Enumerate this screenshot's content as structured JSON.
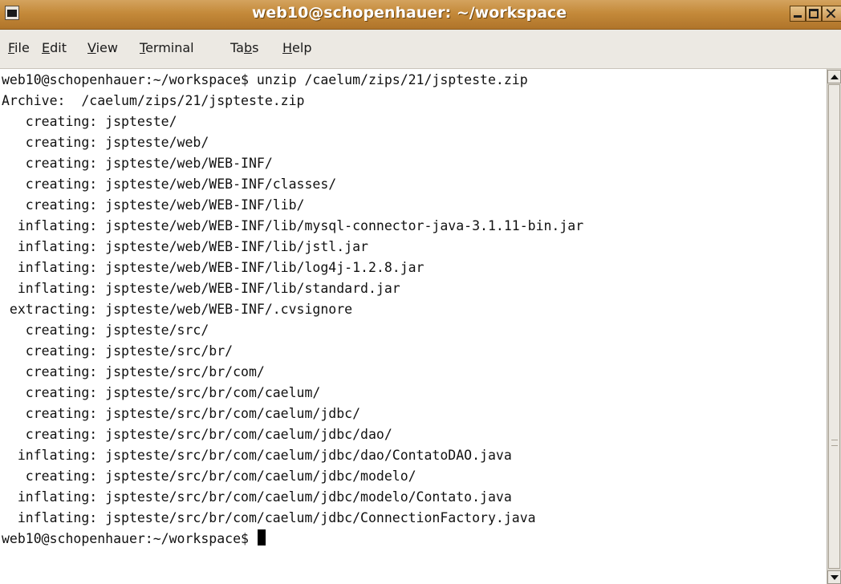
{
  "window": {
    "title": "web10@schopenhauer: ~/workspace"
  },
  "menu": [
    {
      "pre": "",
      "mnemonic": "F",
      "post": "ile"
    },
    {
      "pre": "",
      "mnemonic": "E",
      "post": "dit"
    },
    {
      "pre": "",
      "mnemonic": "V",
      "post": "iew"
    },
    {
      "pre": "",
      "mnemonic": "T",
      "post": "erminal"
    },
    {
      "pre": "Ta",
      "mnemonic": "b",
      "post": "s"
    },
    {
      "pre": "",
      "mnemonic": "H",
      "post": "elp"
    }
  ],
  "terminal": {
    "lines": [
      "web10@schopenhauer:~/workspace$ unzip /caelum/zips/21/jspteste.zip",
      "Archive:  /caelum/zips/21/jspteste.zip",
      "   creating: jspteste/",
      "   creating: jspteste/web/",
      "   creating: jspteste/web/WEB-INF/",
      "   creating: jspteste/web/WEB-INF/classes/",
      "   creating: jspteste/web/WEB-INF/lib/",
      "  inflating: jspteste/web/WEB-INF/lib/mysql-connector-java-3.1.11-bin.jar",
      "  inflating: jspteste/web/WEB-INF/lib/jstl.jar",
      "  inflating: jspteste/web/WEB-INF/lib/log4j-1.2.8.jar",
      "  inflating: jspteste/web/WEB-INF/lib/standard.jar",
      " extracting: jspteste/web/WEB-INF/.cvsignore",
      "   creating: jspteste/src/",
      "   creating: jspteste/src/br/",
      "   creating: jspteste/src/br/com/",
      "   creating: jspteste/src/br/com/caelum/",
      "   creating: jspteste/src/br/com/caelum/jdbc/",
      "   creating: jspteste/src/br/com/caelum/jdbc/dao/",
      "  inflating: jspteste/src/br/com/caelum/jdbc/dao/ContatoDAO.java",
      "   creating: jspteste/src/br/com/caelum/jdbc/modelo/",
      "  inflating: jspteste/src/br/com/caelum/jdbc/modelo/Contato.java",
      "  inflating: jspteste/src/br/com/caelum/jdbc/ConnectionFactory.java"
    ],
    "prompt": "web10@schopenhauer:~/workspace$ "
  },
  "icons": {
    "app": "terminal-app-icon",
    "minimize": "minimize-icon",
    "maximize": "maximize-icon",
    "close": "close-icon",
    "scroll_up": "arrow-up-icon",
    "scroll_down": "arrow-down-icon"
  },
  "colors": {
    "titlebar": "#c48a3a",
    "titlebar_text": "#ffffff",
    "menubar": "#ece9e3",
    "terminal_bg": "#ffffff",
    "terminal_fg": "#111111"
  }
}
